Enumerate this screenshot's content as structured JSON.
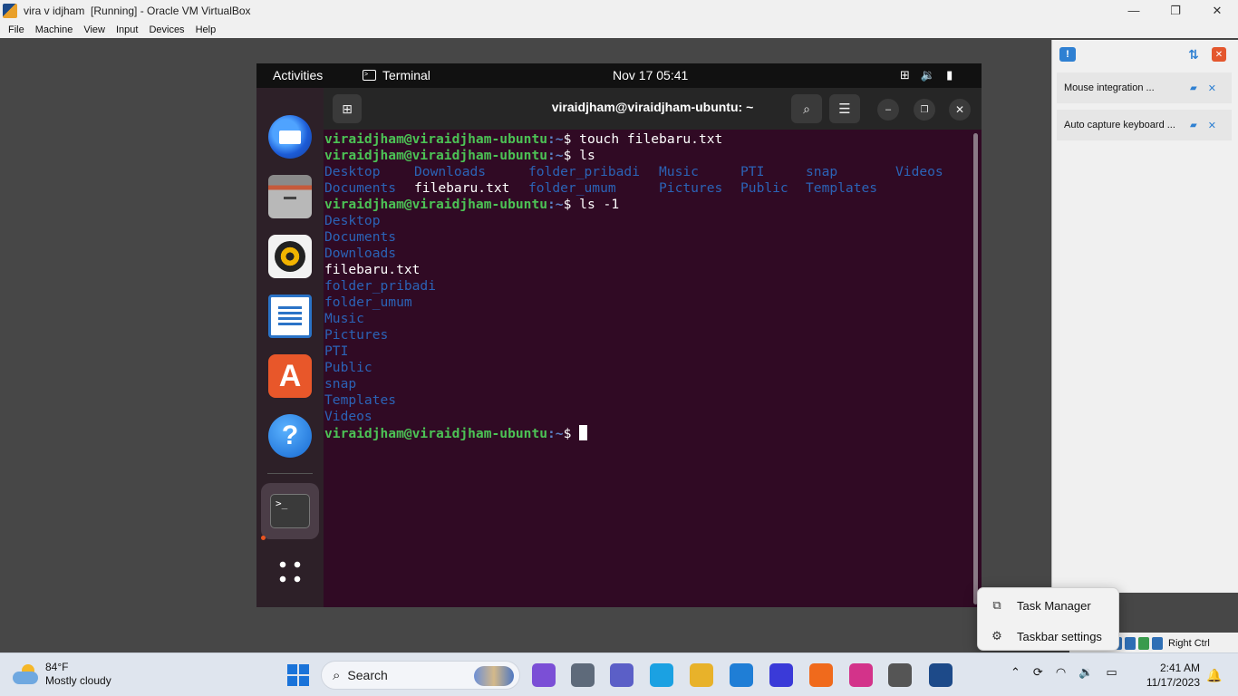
{
  "host_window": {
    "title": "vira v idjham  [Running] - Oracle VM VirtualBox",
    "minimize_glyph": "—",
    "restore_glyph": "❐",
    "close_glyph": "✕",
    "menu": [
      "File",
      "Machine",
      "View",
      "Input",
      "Devices",
      "Help"
    ],
    "host_key_label": "Right Ctrl"
  },
  "notifications": {
    "items": [
      {
        "text": "Mouse integration ..."
      },
      {
        "text": "Auto capture keyboard ..."
      }
    ]
  },
  "guest": {
    "top_bar": {
      "activities": "Activities",
      "app_name": "Terminal",
      "datetime": "Nov 17  05:41"
    },
    "terminal": {
      "title": "viraidjham@viraidjham-ubuntu: ~",
      "prompt_user": "viraidjham@viraidjham-ubuntu",
      "prompt_path": ":~",
      "prompt_symbol": "$ ",
      "commands": [
        "touch filebaru.txt",
        "ls",
        "ls -1"
      ],
      "ls_grid": [
        [
          "Desktop",
          "Documents"
        ],
        [
          "Downloads",
          "filebaru.txt"
        ],
        [
          "folder_pribadi",
          "folder_umum"
        ],
        [
          "Music",
          "Pictures"
        ],
        [
          "PTI",
          "Public"
        ],
        [
          "snap",
          "Templates"
        ],
        [
          "Videos",
          ""
        ]
      ],
      "ls_list": [
        "Desktop",
        "Documents",
        "Downloads",
        "filebaru.txt",
        "folder_pribadi",
        "folder_umum",
        "Music",
        "Pictures",
        "PTI",
        "Public",
        "snap",
        "Templates",
        "Videos"
      ],
      "regular_files": [
        "filebaru.txt"
      ]
    },
    "dock": {
      "apps": [
        "thunderbird-icon",
        "files-icon",
        "rhythmbox-icon",
        "libreoffice-writer-icon",
        "app-center-icon",
        "help-icon",
        "terminal-icon",
        "show-apps-icon"
      ],
      "appcenter_glyph": "A",
      "help_glyph": "?",
      "terminal_glyph": ">_"
    }
  },
  "context_menu": {
    "items": [
      {
        "label": "Task Manager",
        "icon": "task-manager-icon"
      },
      {
        "label": "Taskbar settings",
        "icon": "gear-icon"
      }
    ]
  },
  "taskbar": {
    "weather": {
      "temp": "84°F",
      "condition": "Mostly cloudy"
    },
    "search_placeholder": "Search",
    "clock_time": "2:41 AM",
    "clock_date": "11/17/2023",
    "app_colors": [
      "#7b4fd6",
      "#5e6a7a",
      "#5b5fc7",
      "#1ba1e2",
      "#e8b22a",
      "#1f7ed6",
      "#3a3ad8",
      "#f06a1c",
      "#d3338a",
      "#555555",
      "#1d4a89"
    ]
  },
  "colors": {
    "terminal_bg": "#300a24",
    "prompt_user": "#4cc255",
    "prompt_path": "#5a80c5",
    "directory": "#2b63b6",
    "ubuntu_accent": "#e95420"
  }
}
